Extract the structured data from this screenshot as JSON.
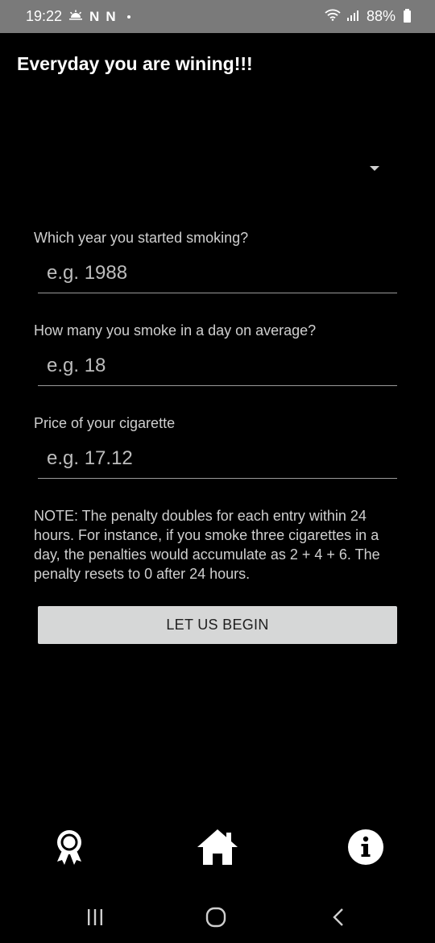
{
  "status_bar": {
    "time": "19:22",
    "notif_1": "N",
    "notif_2": "N",
    "battery": "88%"
  },
  "app": {
    "title": "Everyday you are wining!!!"
  },
  "form": {
    "fields": [
      {
        "label": "Which year you started smoking?",
        "placeholder": "e.g. 1988"
      },
      {
        "label": "How many you smoke in a day on average?",
        "placeholder": "e.g. 18"
      },
      {
        "label": "Price of your cigarette",
        "placeholder": "e.g. 17.12"
      }
    ],
    "note": "NOTE: The penalty doubles for each entry within 24 hours. For instance, if you smoke three cigarettes in a day, the penalties would accumulate as 2 + 4 + 6. The penalty resets to 0 after 24 hours.",
    "submit_label": "LET US BEGIN"
  },
  "bottom_nav": {
    "items": [
      {
        "icon": "award-ribbon-icon"
      },
      {
        "icon": "home-icon"
      },
      {
        "icon": "info-icon"
      }
    ]
  },
  "system_nav": {
    "items": [
      {
        "icon": "recent-apps-icon"
      },
      {
        "icon": "home-circle-icon"
      },
      {
        "icon": "back-icon"
      }
    ]
  },
  "colors": {
    "background": "#000000",
    "status_bar": "#7a7a7a",
    "button_bg": "#d6d7d7",
    "label_text": "#cfcfcf",
    "underline": "#9a9a9a"
  }
}
